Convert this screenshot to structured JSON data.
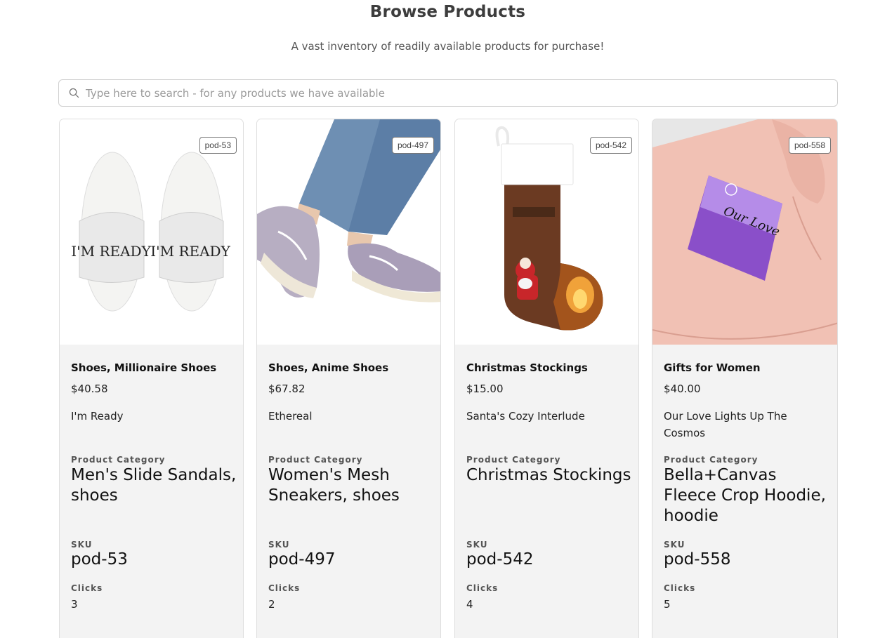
{
  "header": {
    "title": "Browse Products",
    "subtitle": "A vast inventory of readily available products for purchase!"
  },
  "search": {
    "placeholder": "Type here to search - for any products we have available",
    "icon": "search-icon"
  },
  "labels": {
    "category": "Product Category",
    "sku": "SKU",
    "clicks": "Clicks"
  },
  "products": [
    {
      "badge": "pod-53",
      "name": "Shoes, Millionaire Shoes",
      "price": "$40.58",
      "tagline": "I'm Ready",
      "category": "Men's Slide Sandals, shoes",
      "sku": "pod-53",
      "clicks": "3",
      "image_text_left": "I'M READY",
      "image_text_right": "I'M READY"
    },
    {
      "badge": "pod-497",
      "name": "Shoes, Anime Shoes",
      "price": "$67.82",
      "tagline": "Ethereal",
      "category": "Women's Mesh Sneakers, shoes",
      "sku": "pod-497",
      "clicks": "2"
    },
    {
      "badge": "pod-542",
      "name": "Christmas Stockings",
      "price": "$15.00",
      "tagline": "Santa's Cozy Interlude",
      "category": "Christmas Stockings",
      "sku": "pod-542",
      "clicks": "4"
    },
    {
      "badge": "pod-558",
      "name": "Gifts for Women",
      "price": "$40.00",
      "tagline": "Our Love Lights Up The Cosmos",
      "category": "Bella+Canvas Fleece Crop Hoodie, hoodie",
      "sku": "pod-558",
      "clicks": "5",
      "image_text": "Our Love"
    }
  ]
}
